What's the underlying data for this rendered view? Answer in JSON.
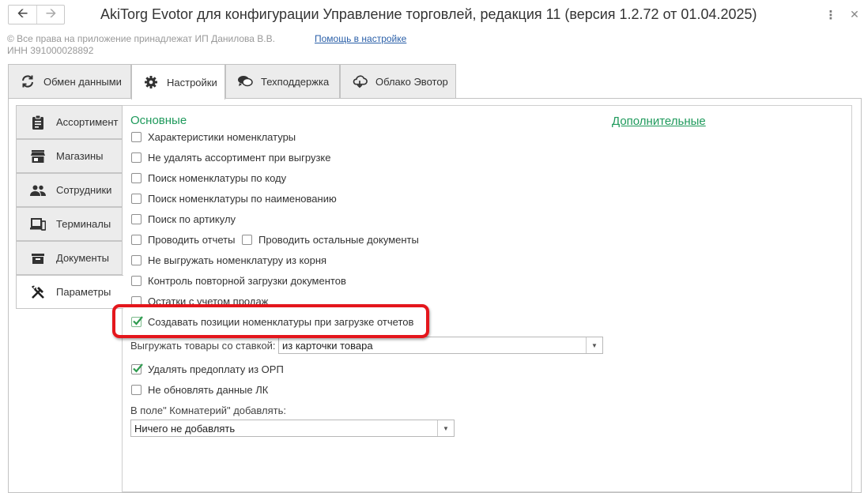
{
  "window": {
    "title": "AkiTorg Evotor для конфигурации Управление торговлей, редакция 11 (версия 1.2.72 от 01.04.2025)",
    "back_icon": "arrow-left-icon",
    "forward_icon": "arrow-right-icon",
    "menu_icon": "more-vertical-icon",
    "close_icon": "close-icon"
  },
  "header": {
    "copyright": "© Все права на приложение принадлежат ИП Данилова В.В.",
    "inn": "ИНН 391000028892",
    "help_link": "Помощь в настройке"
  },
  "main_tabs": [
    {
      "label": "Обмен данными",
      "icon": "sync-icon",
      "active": false
    },
    {
      "label": "Настройки",
      "icon": "gear-icon",
      "active": true
    },
    {
      "label": "Техподдержка",
      "icon": "chat-icon",
      "active": false
    },
    {
      "label": "Облако Эвотор",
      "icon": "cloud-icon",
      "active": false
    }
  ],
  "side_tabs": [
    {
      "label": "Ассортимент",
      "icon": "clipboard-icon",
      "active": false
    },
    {
      "label": "Магазины",
      "icon": "store-icon",
      "active": false
    },
    {
      "label": "Сотрудники",
      "icon": "people-icon",
      "active": false
    },
    {
      "label": "Терминалы",
      "icon": "devices-icon",
      "active": false
    },
    {
      "label": "Документы",
      "icon": "box-icon",
      "active": false
    },
    {
      "label": "Параметры",
      "icon": "tools-icon",
      "active": true
    }
  ],
  "settings": {
    "section_main": "Основные",
    "section_extra": "Дополнительные",
    "checkboxes": [
      {
        "label": "Характеристики номенклатуры",
        "checked": false
      },
      {
        "label": "Не удалять ассортимент при выгрузке",
        "checked": false
      },
      {
        "label": "Поиск номенклатуры по коду",
        "checked": false
      },
      {
        "label": "Поиск номенклатуры по наименованию",
        "checked": false
      },
      {
        "label": "Поиск по артикулу",
        "checked": false
      },
      {
        "label": "Проводить отчеты",
        "checked": false
      },
      {
        "label": "Проводить остальные документы",
        "checked": false
      },
      {
        "label": "Не выгружать номенклатуру из корня",
        "checked": false
      },
      {
        "label": "Контроль повторной загрузки документов",
        "checked": false
      },
      {
        "label": "Остатки с учетом продаж",
        "checked": false
      },
      {
        "label": "Создавать позиции номенклатуры при загрузке отчетов",
        "checked": true
      },
      {
        "label": "Удалять предоплату из ОРП",
        "checked": true
      },
      {
        "label": "Не обновлять данные ЛК",
        "checked": false
      }
    ],
    "vat_label": "Выгружать товары со ставкой:",
    "vat_value": "из карточки товара",
    "comment_label": "В поле\" Комнатерий\" добавлять:",
    "comment_value": "Ничего не добавлять"
  },
  "colors": {
    "accent_green": "#1f9a5c",
    "link_blue": "#2a5fa8",
    "highlight_red": "#e4161c",
    "check_green": "#2e9b4f"
  }
}
